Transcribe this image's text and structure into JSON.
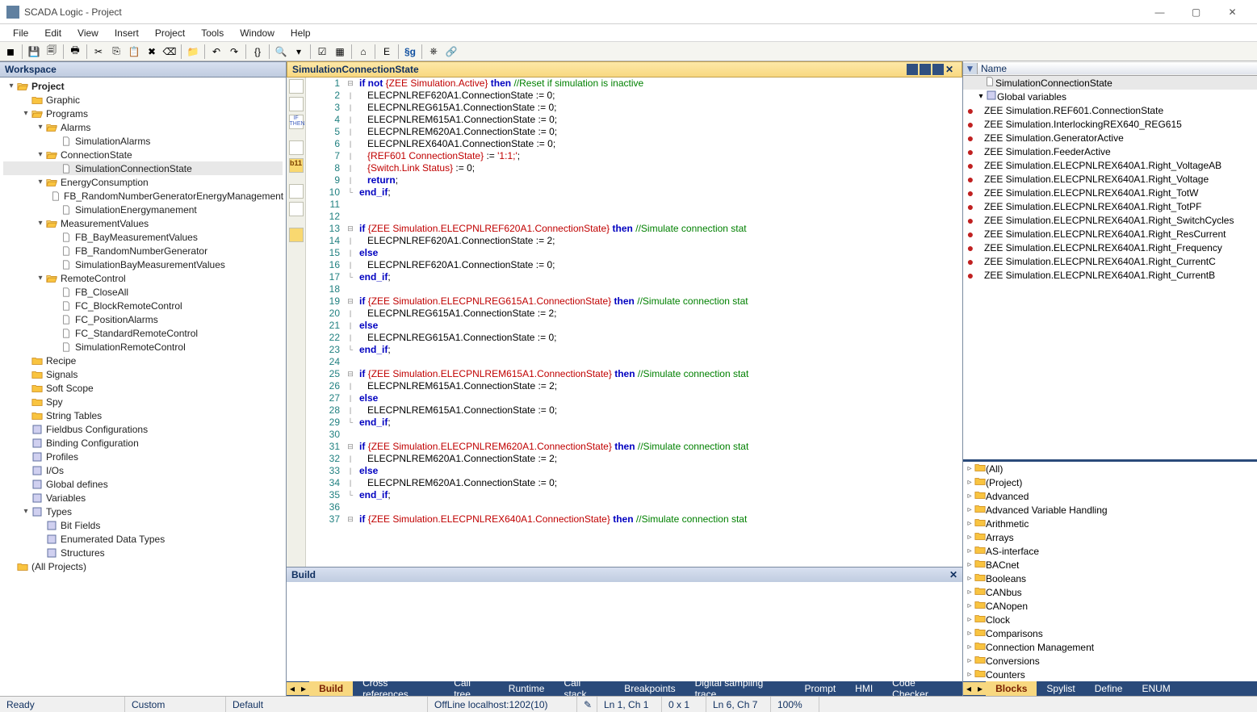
{
  "window": {
    "title": "SCADA Logic - Project"
  },
  "menu": [
    "File",
    "Edit",
    "View",
    "Insert",
    "Project",
    "Tools",
    "Window",
    "Help"
  ],
  "workspace": {
    "title": "Workspace",
    "tree": [
      {
        "d": 0,
        "exp": "▾",
        "icon": "folder-open",
        "label": "Project",
        "bold": true
      },
      {
        "d": 1,
        "exp": "",
        "icon": "folder",
        "label": "Graphic"
      },
      {
        "d": 1,
        "exp": "▾",
        "icon": "folder-open",
        "label": "Programs"
      },
      {
        "d": 2,
        "exp": "▾",
        "icon": "folder-open",
        "label": "Alarms"
      },
      {
        "d": 3,
        "exp": "",
        "icon": "file",
        "label": "SimulationAlarms"
      },
      {
        "d": 2,
        "exp": "▾",
        "icon": "folder-open",
        "label": "ConnectionState"
      },
      {
        "d": 3,
        "exp": "",
        "icon": "file",
        "label": "SimulationConnectionState",
        "sel": true
      },
      {
        "d": 2,
        "exp": "▾",
        "icon": "folder-open",
        "label": "EnergyConsumption"
      },
      {
        "d": 3,
        "exp": "",
        "icon": "file",
        "label": "FB_RandomNumberGeneratorEnergyManagement"
      },
      {
        "d": 3,
        "exp": "",
        "icon": "file",
        "label": "SimulationEnergymanement"
      },
      {
        "d": 2,
        "exp": "▾",
        "icon": "folder-open",
        "label": "MeasurementValues"
      },
      {
        "d": 3,
        "exp": "",
        "icon": "file",
        "label": "FB_BayMeasurementValues"
      },
      {
        "d": 3,
        "exp": "",
        "icon": "file",
        "label": "FB_RandomNumberGenerator"
      },
      {
        "d": 3,
        "exp": "",
        "icon": "file",
        "label": "SimulationBayMeasurementValues"
      },
      {
        "d": 2,
        "exp": "▾",
        "icon": "folder-open",
        "label": "RemoteControl"
      },
      {
        "d": 3,
        "exp": "",
        "icon": "file",
        "label": "FB_CloseAll"
      },
      {
        "d": 3,
        "exp": "",
        "icon": "file",
        "label": "FC_BlockRemoteControl"
      },
      {
        "d": 3,
        "exp": "",
        "icon": "file",
        "label": "FC_PositionAlarms"
      },
      {
        "d": 3,
        "exp": "",
        "icon": "file",
        "label": "FC_StandardRemoteControl"
      },
      {
        "d": 3,
        "exp": "",
        "icon": "file",
        "label": "SimulationRemoteControl"
      },
      {
        "d": 1,
        "exp": "",
        "icon": "folder",
        "label": "Recipe"
      },
      {
        "d": 1,
        "exp": "",
        "icon": "folder",
        "label": "Signals"
      },
      {
        "d": 1,
        "exp": "",
        "icon": "folder",
        "label": "Soft Scope"
      },
      {
        "d": 1,
        "exp": "",
        "icon": "folder",
        "label": "Spy"
      },
      {
        "d": 1,
        "exp": "",
        "icon": "folder",
        "label": "String Tables"
      },
      {
        "d": 1,
        "exp": "",
        "icon": "fieldbus",
        "label": "Fieldbus Configurations"
      },
      {
        "d": 1,
        "exp": "",
        "icon": "binding",
        "label": "Binding Configuration"
      },
      {
        "d": 1,
        "exp": "",
        "icon": "profiles",
        "label": "Profiles"
      },
      {
        "d": 1,
        "exp": "",
        "icon": "ios",
        "label": "I/Os"
      },
      {
        "d": 1,
        "exp": "",
        "icon": "globals",
        "label": "Global defines"
      },
      {
        "d": 1,
        "exp": "",
        "icon": "vars",
        "label": "Variables"
      },
      {
        "d": 1,
        "exp": "▾",
        "icon": "types",
        "label": "Types"
      },
      {
        "d": 2,
        "exp": "",
        "icon": "type",
        "label": "Bit Fields"
      },
      {
        "d": 2,
        "exp": "",
        "icon": "type",
        "label": "Enumerated Data Types"
      },
      {
        "d": 2,
        "exp": "",
        "icon": "type",
        "label": "Structures"
      },
      {
        "d": 0,
        "exp": "",
        "icon": "folder",
        "label": "(All Projects)"
      }
    ]
  },
  "editor": {
    "title": "SimulationConnectionState",
    "lines": [
      {
        "n": 1,
        "f": "⊟",
        "html": "<span class='kw'>if not</span> <span class='bracevar'>{ZEE Simulation.Active}</span> <span class='kw'>then</span> <span class='cmt'>//Reset if simulation is inactive</span>"
      },
      {
        "n": 2,
        "f": "|",
        "html": "   ELECPNLREF620A1.ConnectionState := 0;"
      },
      {
        "n": 3,
        "f": "|",
        "html": "   ELECPNLREG615A1.ConnectionState := 0;"
      },
      {
        "n": 4,
        "f": "|",
        "html": "   ELECPNLREM615A1.ConnectionState := 0;"
      },
      {
        "n": 5,
        "f": "|",
        "html": "   ELECPNLREM620A1.ConnectionState := 0;"
      },
      {
        "n": 6,
        "f": "|",
        "html": "   ELECPNLREX640A1.ConnectionState := 0;"
      },
      {
        "n": 7,
        "f": "|",
        "html": "   <span class='bracevar'>{REF601 ConnectionState}</span> := <span class='str'>'1:1;'</span>;"
      },
      {
        "n": 8,
        "f": "|",
        "html": "   <span class='bracevar'>{Switch.Link Status}</span> := 0;"
      },
      {
        "n": 9,
        "f": "|",
        "html": "   <span class='kw'>return</span>;"
      },
      {
        "n": 10,
        "f": "└",
        "html": "<span class='kw'>end_if</span>;"
      },
      {
        "n": 11,
        "f": "",
        "html": ""
      },
      {
        "n": 12,
        "f": "",
        "html": ""
      },
      {
        "n": 13,
        "f": "⊟",
        "html": "<span class='kw'>if</span> <span class='bracevar'>{ZEE Simulation.ELECPNLREF620A1.ConnectionState}</span> <span class='kw'>then</span> <span class='cmt'>//Simulate connection stat</span>"
      },
      {
        "n": 14,
        "f": "|",
        "html": "   ELECPNLREF620A1.ConnectionState := 2;"
      },
      {
        "n": 15,
        "f": "|",
        "html": "<span class='kw'>else</span>"
      },
      {
        "n": 16,
        "f": "|",
        "html": "   ELECPNLREF620A1.ConnectionState := 0;"
      },
      {
        "n": 17,
        "f": "└",
        "html": "<span class='kw'>end_if</span>;"
      },
      {
        "n": 18,
        "f": "",
        "html": ""
      },
      {
        "n": 19,
        "f": "⊟",
        "html": "<span class='kw'>if</span> <span class='bracevar'>{ZEE Simulation.ELECPNLREG615A1.ConnectionState}</span> <span class='kw'>then</span> <span class='cmt'>//Simulate connection stat</span>"
      },
      {
        "n": 20,
        "f": "|",
        "html": "   ELECPNLREG615A1.ConnectionState := 2;"
      },
      {
        "n": 21,
        "f": "|",
        "html": "<span class='kw'>else</span>"
      },
      {
        "n": 22,
        "f": "|",
        "html": "   ELECPNLREG615A1.ConnectionState := 0;"
      },
      {
        "n": 23,
        "f": "└",
        "html": "<span class='kw'>end_if</span>;"
      },
      {
        "n": 24,
        "f": "",
        "html": ""
      },
      {
        "n": 25,
        "f": "⊟",
        "html": "<span class='kw'>if</span> <span class='bracevar'>{ZEE Simulation.ELECPNLREM615A1.ConnectionState}</span> <span class='kw'>then</span> <span class='cmt'>//Simulate connection stat</span>"
      },
      {
        "n": 26,
        "f": "|",
        "html": "   ELECPNLREM615A1.ConnectionState := 2;"
      },
      {
        "n": 27,
        "f": "|",
        "html": "<span class='kw'>else</span>"
      },
      {
        "n": 28,
        "f": "|",
        "html": "   ELECPNLREM615A1.ConnectionState := 0;"
      },
      {
        "n": 29,
        "f": "└",
        "html": "<span class='kw'>end_if</span>;"
      },
      {
        "n": 30,
        "f": "",
        "html": ""
      },
      {
        "n": 31,
        "f": "⊟",
        "html": "<span class='kw'>if</span> <span class='bracevar'>{ZEE Simulation.ELECPNLREM620A1.ConnectionState}</span> <span class='kw'>then</span> <span class='cmt'>//Simulate connection stat</span>"
      },
      {
        "n": 32,
        "f": "|",
        "html": "   ELECPNLREM620A1.ConnectionState := 2;"
      },
      {
        "n": 33,
        "f": "|",
        "html": "<span class='kw'>else</span>"
      },
      {
        "n": 34,
        "f": "|",
        "html": "   ELECPNLREM620A1.ConnectionState := 0;"
      },
      {
        "n": 35,
        "f": "└",
        "html": "<span class='kw'>end_if</span>;"
      },
      {
        "n": 36,
        "f": "",
        "html": ""
      },
      {
        "n": 37,
        "f": "⊟",
        "html": "<span class='kw'>if</span> <span class='bracevar'>{ZEE Simulation.ELECPNLREX640A1.ConnectionState}</span> <span class='kw'>then</span> <span class='cmt'>//Simulate connection stat</span>"
      }
    ]
  },
  "build": {
    "title": "Build",
    "tabs": [
      "Build",
      "Cross references",
      "Call tree",
      "Runtime",
      "Call stack",
      "Breakpoints",
      "Digital sampling trace",
      "Prompt",
      "HMI",
      "Code Checker"
    ]
  },
  "rightTop": {
    "column": "Name",
    "rows": [
      {
        "bullet": "",
        "indent": 1,
        "icon": "file",
        "label": "SimulationConnectionState",
        "sel": true
      },
      {
        "bullet": "",
        "indent": 0,
        "exp": "▾",
        "icon": "home",
        "label": "Global variables"
      },
      {
        "bullet": "●",
        "indent": 1,
        "label": "ZEE Simulation.REF601.ConnectionState"
      },
      {
        "bullet": "●",
        "indent": 1,
        "label": "ZEE Simulation.InterlockingREX640_REG615"
      },
      {
        "bullet": "●",
        "indent": 1,
        "label": "ZEE Simulation.GeneratorActive"
      },
      {
        "bullet": "●",
        "indent": 1,
        "label": "ZEE Simulation.FeederActive"
      },
      {
        "bullet": "●",
        "indent": 1,
        "label": "ZEE Simulation.ELECPNLREX640A1.Right_VoltageAB"
      },
      {
        "bullet": "●",
        "indent": 1,
        "label": "ZEE Simulation.ELECPNLREX640A1.Right_Voltage"
      },
      {
        "bullet": "●",
        "indent": 1,
        "label": "ZEE Simulation.ELECPNLREX640A1.Right_TotW"
      },
      {
        "bullet": "●",
        "indent": 1,
        "label": "ZEE Simulation.ELECPNLREX640A1.Right_TotPF"
      },
      {
        "bullet": "●",
        "indent": 1,
        "label": "ZEE Simulation.ELECPNLREX640A1.Right_SwitchCycles"
      },
      {
        "bullet": "●",
        "indent": 1,
        "label": "ZEE Simulation.ELECPNLREX640A1.Right_ResCurrent"
      },
      {
        "bullet": "●",
        "indent": 1,
        "label": "ZEE Simulation.ELECPNLREX640A1.Right_Frequency"
      },
      {
        "bullet": "●",
        "indent": 1,
        "label": "ZEE Simulation.ELECPNLREX640A1.Right_CurrentC"
      },
      {
        "bullet": "●",
        "indent": 1,
        "label": "ZEE Simulation.ELECPNLREX640A1.Right_CurrentB"
      }
    ]
  },
  "rightBottom": {
    "categories": [
      "(All)",
      "(Project)",
      "Advanced",
      "Advanced Variable Handling",
      "Arithmetic",
      "Arrays",
      "AS-interface",
      "BACnet",
      "Booleans",
      "CANbus",
      "CANopen",
      "Clock",
      "Comparisons",
      "Connection Management",
      "Conversions",
      "Counters"
    ],
    "tabs": [
      "Blocks",
      "Spylist",
      "Define",
      "ENUM"
    ]
  },
  "status": {
    "ready": "Ready",
    "custom": "Custom",
    "default": "Default",
    "conn": "OffLine  localhost:1202(10)",
    "pos1": "Ln 1, Ch 1",
    "size": "0 x 1",
    "pos2": "Ln 6, Ch 7",
    "zoom": "100%"
  }
}
